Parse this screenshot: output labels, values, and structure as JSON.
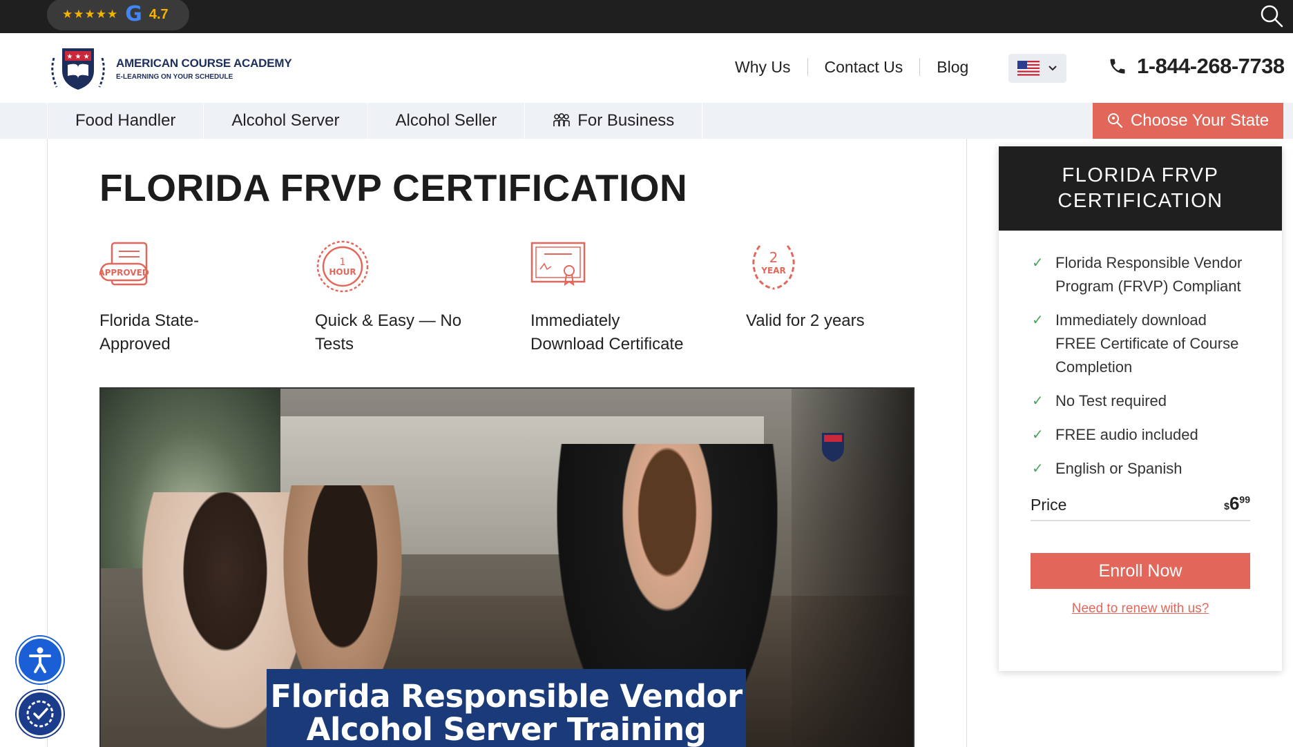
{
  "topbar": {
    "stars": "★★★★★",
    "google_letter": "G",
    "rating": "4.7",
    "search_icon": "search-icon"
  },
  "header": {
    "logo_title": "AMERICAN COURSE ACADEMY",
    "logo_tagline": "E-LEARNING ON YOUR SCHEDULE",
    "nav": [
      "Why Us",
      "Contact Us",
      "Blog"
    ],
    "language_flag": "us-flag-icon",
    "phone": "1-844-268-7738"
  },
  "subnav": {
    "items": [
      "Food Handler",
      "Alcohol Server",
      "Alcohol Seller",
      "For Business"
    ],
    "cta": "Choose Your State"
  },
  "main": {
    "title": "FLORIDA FRVP CERTIFICATION",
    "features": [
      {
        "text": "Florida State-Approved",
        "icon": "approved-stamp-icon",
        "icon_text": "APPROVED"
      },
      {
        "text": "Quick & Easy — No Tests",
        "icon": "one-hour-icon",
        "icon_text_top": "1",
        "icon_text_bottom": "HOUR"
      },
      {
        "text": "Immediately Download Certificate",
        "icon": "certificate-icon"
      },
      {
        "text": "Valid for 2 years",
        "icon": "two-year-laurel-icon",
        "icon_text_top": "2",
        "icon_text_bottom": "YEAR"
      }
    ],
    "hero_caption_line1": "Florida Responsible Vendor",
    "hero_caption_line2": "Alcohol Server Training"
  },
  "card": {
    "title": "FLORIDA FRVP CERTIFICATION",
    "features": [
      "Florida Responsible Vendor Program (FRVP) Compliant",
      "Immediately download FREE Certificate of Course Completion",
      "No Test required",
      "FREE audio included",
      "English or Spanish"
    ],
    "price_label": "Price",
    "price_currency": "$",
    "price_whole": "6",
    "price_cents": "99",
    "enroll": "Enroll Now",
    "renew": "Need to renew with us?"
  },
  "colors": {
    "accent": "#e2675a",
    "dark": "#1f1f1f",
    "navy": "#1d2d5c",
    "check": "#4aa35a",
    "subnav_bg": "#eef2f7"
  }
}
